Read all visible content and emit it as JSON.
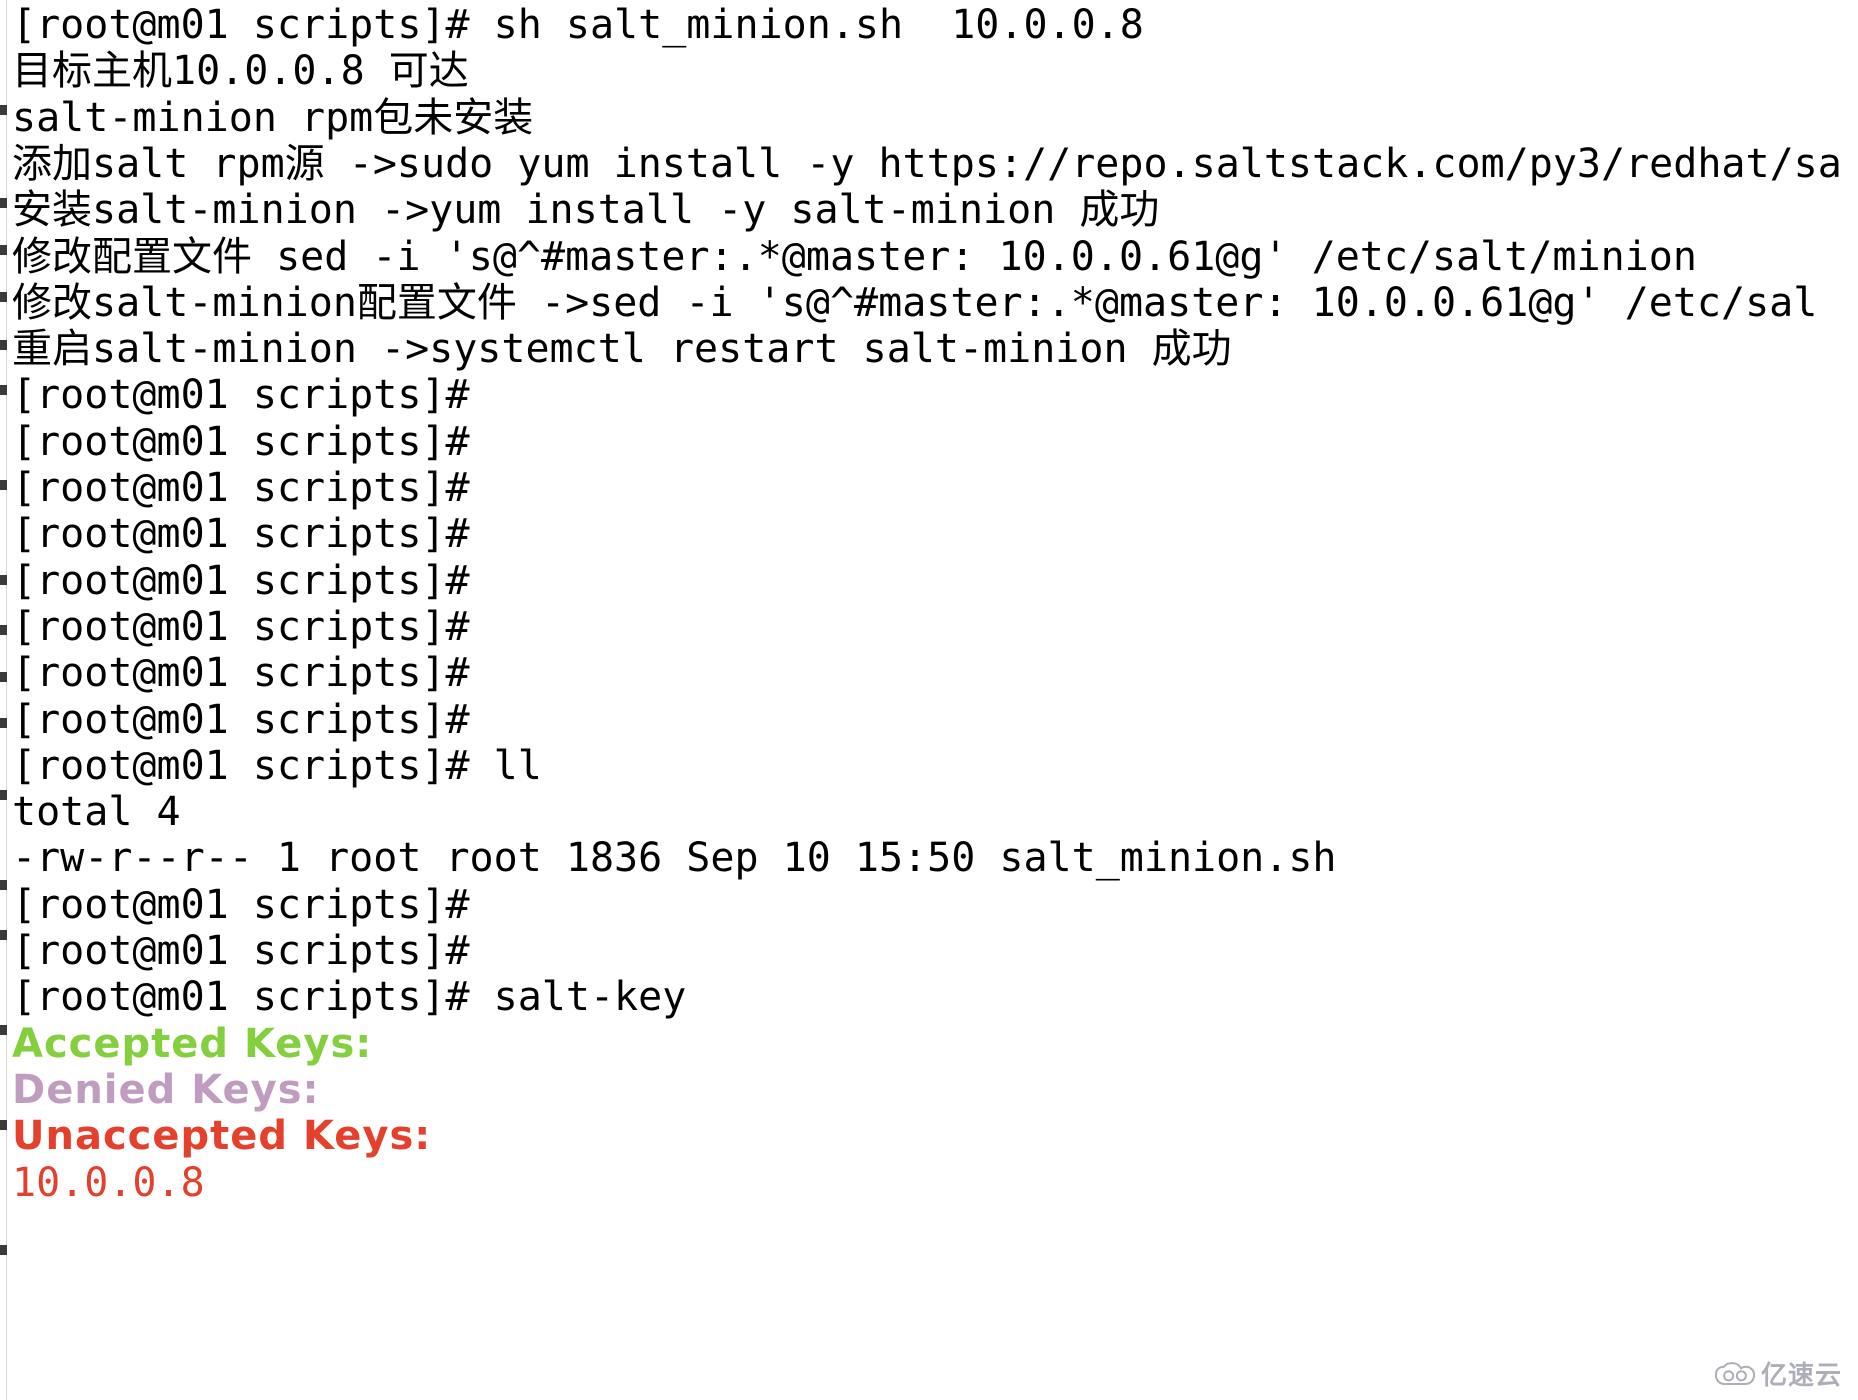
{
  "terminal": {
    "background_color": "#ffffff",
    "foreground_color": "#000000",
    "colors": {
      "accepted_green": "#83cf3e",
      "denied_purple": "#c09cc0",
      "unaccepted_red": "#e4402c"
    },
    "lines": [
      {
        "text": "[root@m01 scripts]# sh salt_minion.sh  10.0.0.8",
        "color": "default"
      },
      {
        "text": "目标主机10.0.0.8 可达",
        "color": "default"
      },
      {
        "text": "salt-minion rpm包未安装",
        "color": "default"
      },
      {
        "text": "添加salt rpm源 ->sudo yum install -y https://repo.saltstack.com/py3/redhat/sa",
        "color": "default"
      },
      {
        "text": "安装salt-minion ->yum install -y salt-minion 成功",
        "color": "default"
      },
      {
        "text": "修改配置文件 sed -i 's@^#master:.*@master: 10.0.0.61@g' /etc/salt/minion",
        "color": "default"
      },
      {
        "text": "修改salt-minion配置文件 ->sed -i 's@^#master:.*@master: 10.0.0.61@g' /etc/sal",
        "color": "default"
      },
      {
        "text": "重启salt-minion ->systemctl restart salt-minion 成功",
        "color": "default"
      },
      {
        "text": "[root@m01 scripts]#",
        "color": "default"
      },
      {
        "text": "[root@m01 scripts]#",
        "color": "default"
      },
      {
        "text": "[root@m01 scripts]#",
        "color": "default"
      },
      {
        "text": "[root@m01 scripts]#",
        "color": "default"
      },
      {
        "text": "[root@m01 scripts]#",
        "color": "default"
      },
      {
        "text": "[root@m01 scripts]#",
        "color": "default"
      },
      {
        "text": "[root@m01 scripts]#",
        "color": "default"
      },
      {
        "text": "[root@m01 scripts]#",
        "color": "default"
      },
      {
        "text": "[root@m01 scripts]# ll",
        "color": "default"
      },
      {
        "text": "total 4",
        "color": "default"
      },
      {
        "text": "-rw-r--r-- 1 root root 1836 Sep 10 15:50 salt_minion.sh",
        "color": "default"
      },
      {
        "text": "[root@m01 scripts]#",
        "color": "default"
      },
      {
        "text": "[root@m01 scripts]#",
        "color": "default"
      },
      {
        "text": "[root@m01 scripts]# salt-key",
        "color": "default"
      },
      {
        "text": "Accepted Keys:",
        "color": "green"
      },
      {
        "text": "Denied Keys:",
        "color": "purple"
      },
      {
        "text": "Unaccepted Keys:",
        "color": "red"
      },
      {
        "text": "10.0.0.8",
        "color": "red-plain"
      }
    ]
  },
  "watermark": {
    "text": "亿速云",
    "logo": "cloud-swirl-logo"
  }
}
